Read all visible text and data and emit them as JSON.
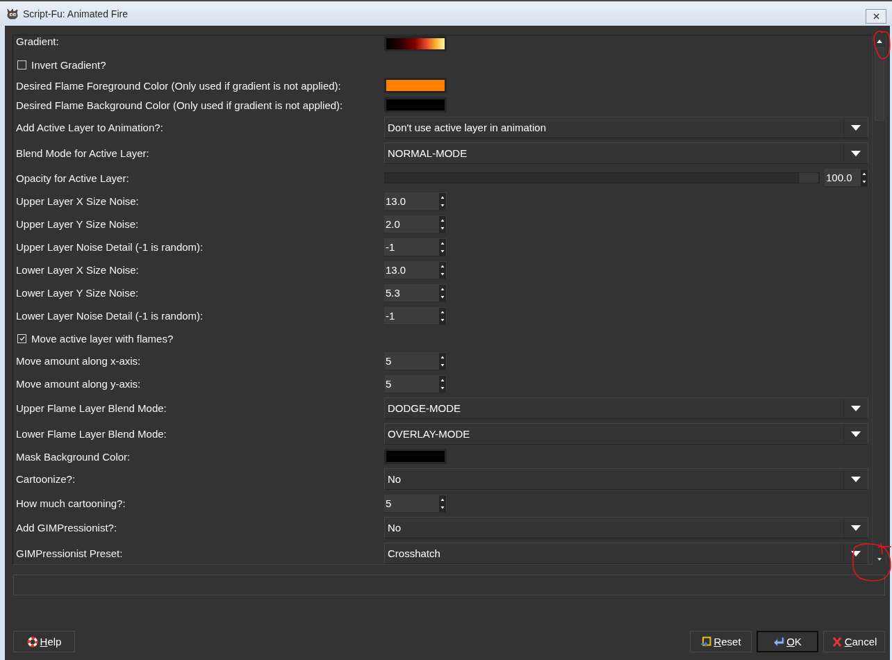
{
  "window": {
    "title": "Script-Fu: Animated Fire"
  },
  "params": [
    {
      "kind": "gradient",
      "label": "Gradient:"
    },
    {
      "kind": "toggle",
      "label": "Invert Gradient?",
      "checked": false
    },
    {
      "kind": "color",
      "label": "Desired Flame Foreground Color (Only used if gradient is not applied):",
      "color": "#ff8000"
    },
    {
      "kind": "color",
      "label": "Desired Flame Background Color (Only used if gradient is not applied):",
      "color": "#000000"
    },
    {
      "kind": "dropdown",
      "label": "Add Active Layer to Animation?:",
      "value": "Don't use active layer in animation"
    },
    {
      "kind": "dropdown",
      "label": "Blend Mode for Active Layer:",
      "value": "NORMAL-MODE"
    },
    {
      "kind": "slider",
      "label": "Opacity for Active Layer:",
      "level": 1.0,
      "value": "100.0"
    },
    {
      "kind": "spin",
      "label": "Upper Layer X Size Noise:",
      "value": "13.0"
    },
    {
      "kind": "spin",
      "label": "Upper Layer Y Size Noise:",
      "value": "2.0"
    },
    {
      "kind": "spin",
      "label": "Upper Layer Noise Detail (-1 is random):",
      "value": "-1"
    },
    {
      "kind": "spin",
      "label": "Lower Layer X Size Noise:",
      "value": "13.0"
    },
    {
      "kind": "spin",
      "label": "Lower Layer Y Size Noise:",
      "value": "5.3"
    },
    {
      "kind": "spin",
      "label": "Lower Layer Noise Detail (-1 is random):",
      "value": "-1"
    },
    {
      "kind": "toggle",
      "label": "Move active layer with flames?",
      "checked": true
    },
    {
      "kind": "spin",
      "label": "Move amount along x-axis:",
      "value": "5"
    },
    {
      "kind": "spin",
      "label": "Move amount along y-axis:",
      "value": "5"
    },
    {
      "kind": "dropdown",
      "label": "Upper Flame Layer Blend Mode:",
      "value": "DODGE-MODE"
    },
    {
      "kind": "dropdown",
      "label": "Lower Flame Layer Blend Mode:",
      "value": "OVERLAY-MODE"
    },
    {
      "kind": "color",
      "label": "Mask Background Color:",
      "color": "#000000"
    },
    {
      "kind": "dropdown",
      "label": "Cartoonize?:",
      "value": "No"
    },
    {
      "kind": "spin",
      "label": "How much cartooning?:",
      "value": "5"
    },
    {
      "kind": "dropdown",
      "label": "Add GIMPressionist?:",
      "value": "No"
    },
    {
      "kind": "dropdown",
      "label": "GIMPressionist Preset:",
      "value": "Crosshatch"
    }
  ],
  "scrollbar": {
    "top_circled": true,
    "bottom_circled": true
  },
  "buttons": [
    {
      "kind": "help",
      "label": "Help",
      "default": false
    },
    {
      "kind": "reset",
      "label": "Reset",
      "default": false
    },
    {
      "kind": "ok",
      "label": "OK",
      "default": true
    },
    {
      "kind": "cancel",
      "label": "Cancel",
      "default": false
    }
  ]
}
